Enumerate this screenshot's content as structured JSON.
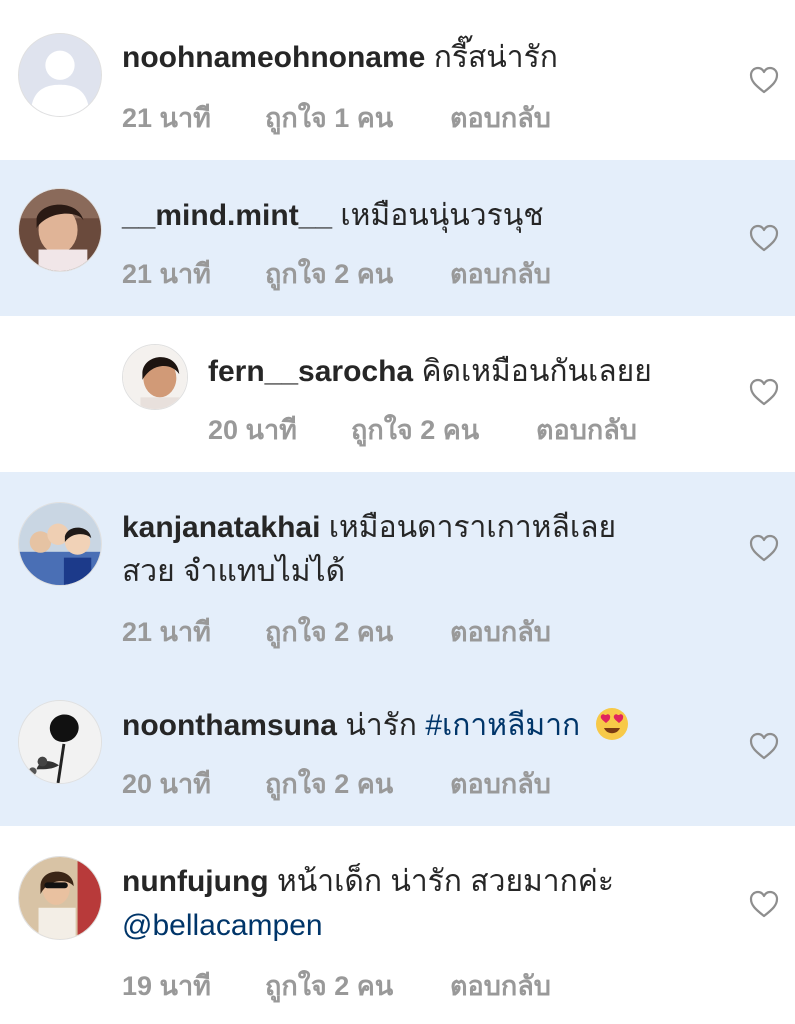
{
  "colors": {
    "highlight_bg": "#e4eefa",
    "username": "#262626",
    "meta": "#999999",
    "hashtag": "#003569"
  },
  "comments": [
    {
      "username": "noohnameohnoname",
      "text": "กรี๊สน่ารัก",
      "time": "21 นาที",
      "likes": "ถูกใจ 1 คน",
      "reply": "ตอบกลับ"
    },
    {
      "username": "__mind.mint__",
      "text": "เหมือนนุ่นวรนุช",
      "time": "21 นาที",
      "likes": "ถูกใจ 2 คน",
      "reply": "ตอบกลับ"
    },
    {
      "username": "fern__sarocha",
      "text": "คิดเหมือนกันเลยย",
      "time": "20 นาที",
      "likes": "ถูกใจ 2 คน",
      "reply": "ตอบกลับ"
    },
    {
      "username": "kanjanatakhai",
      "text": "เหมือนดาราเกาหลีเลย",
      "text2": "สวย จำแทบไม่ได้",
      "time": "21 นาที",
      "likes": "ถูกใจ 2 คน",
      "reply": "ตอบกลับ"
    },
    {
      "username": "noonthamsuna",
      "text": "น่ารัก",
      "hashtag": "#เกาหลีมาก",
      "emoji": "smiling-face-with-heart-eyes",
      "time": "20 นาที",
      "likes": "ถูกใจ 2 คน",
      "reply": "ตอบกลับ"
    },
    {
      "username": "nunfujung",
      "text": "หน้าเด็ก น่ารัก สวยมากค่ะ",
      "mention": "@bellacampen",
      "time": "19 นาที",
      "likes": "ถูกใจ 2 คน",
      "reply": "ตอบกลับ"
    }
  ]
}
